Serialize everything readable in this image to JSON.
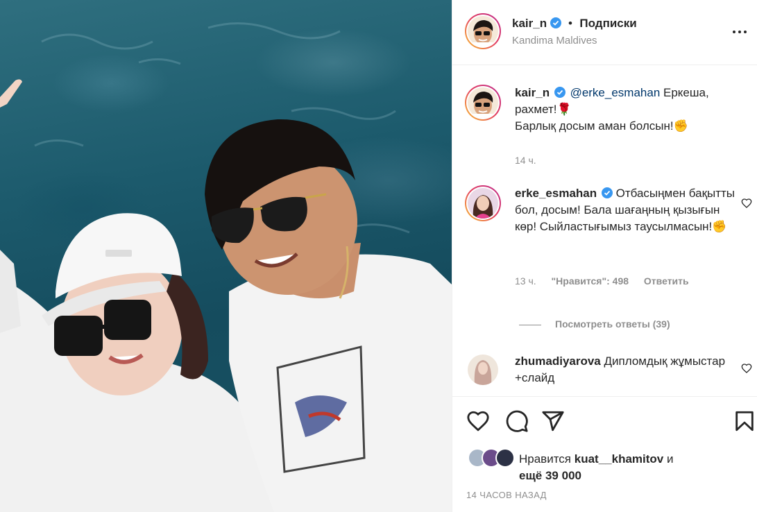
{
  "post": {
    "author": "kair_n",
    "follow_label": "Подписки",
    "dot": "•",
    "location": "Kandima Maldives"
  },
  "caption": {
    "author": "kair_n",
    "mention": "@erke_esmahan",
    "text_line1": " Еркеша,",
    "text_line2": "рахмет!🌹",
    "text_line3": "Барлық досым аман болсын!✊",
    "time": "14 ч."
  },
  "comments": [
    {
      "author": "erke_esmahan",
      "verified": true,
      "text": " Отбасыңмен бақытты бол, досым! Бала шағаңның қызығын көр! Сыйластығымыз таусылмасын!✊",
      "time": "13 ч.",
      "likes_label": "\"Нравится\": 498",
      "reply_label": "Ответить",
      "view_replies": "Посмотреть ответы (39)"
    },
    {
      "author": "zhumadiyarova",
      "verified": false,
      "text": " Дипломдық жұмыстар +слайд"
    }
  ],
  "likes": {
    "prefix": "Нравится ",
    "user": "kuat__khamitov",
    "suffix": " и",
    "more": "ещё 39 000"
  },
  "timestamp": "14 ЧАСОВ НАЗАД",
  "icons": {
    "like": "heart-icon",
    "comment": "comment-icon",
    "share": "share-icon",
    "save": "bookmark-icon",
    "more": "more-options-icon",
    "verified": "verified-badge-icon"
  },
  "colors": {
    "verified": "#3897f0",
    "muted": "#8e8e8e",
    "mention": "#00376b"
  }
}
